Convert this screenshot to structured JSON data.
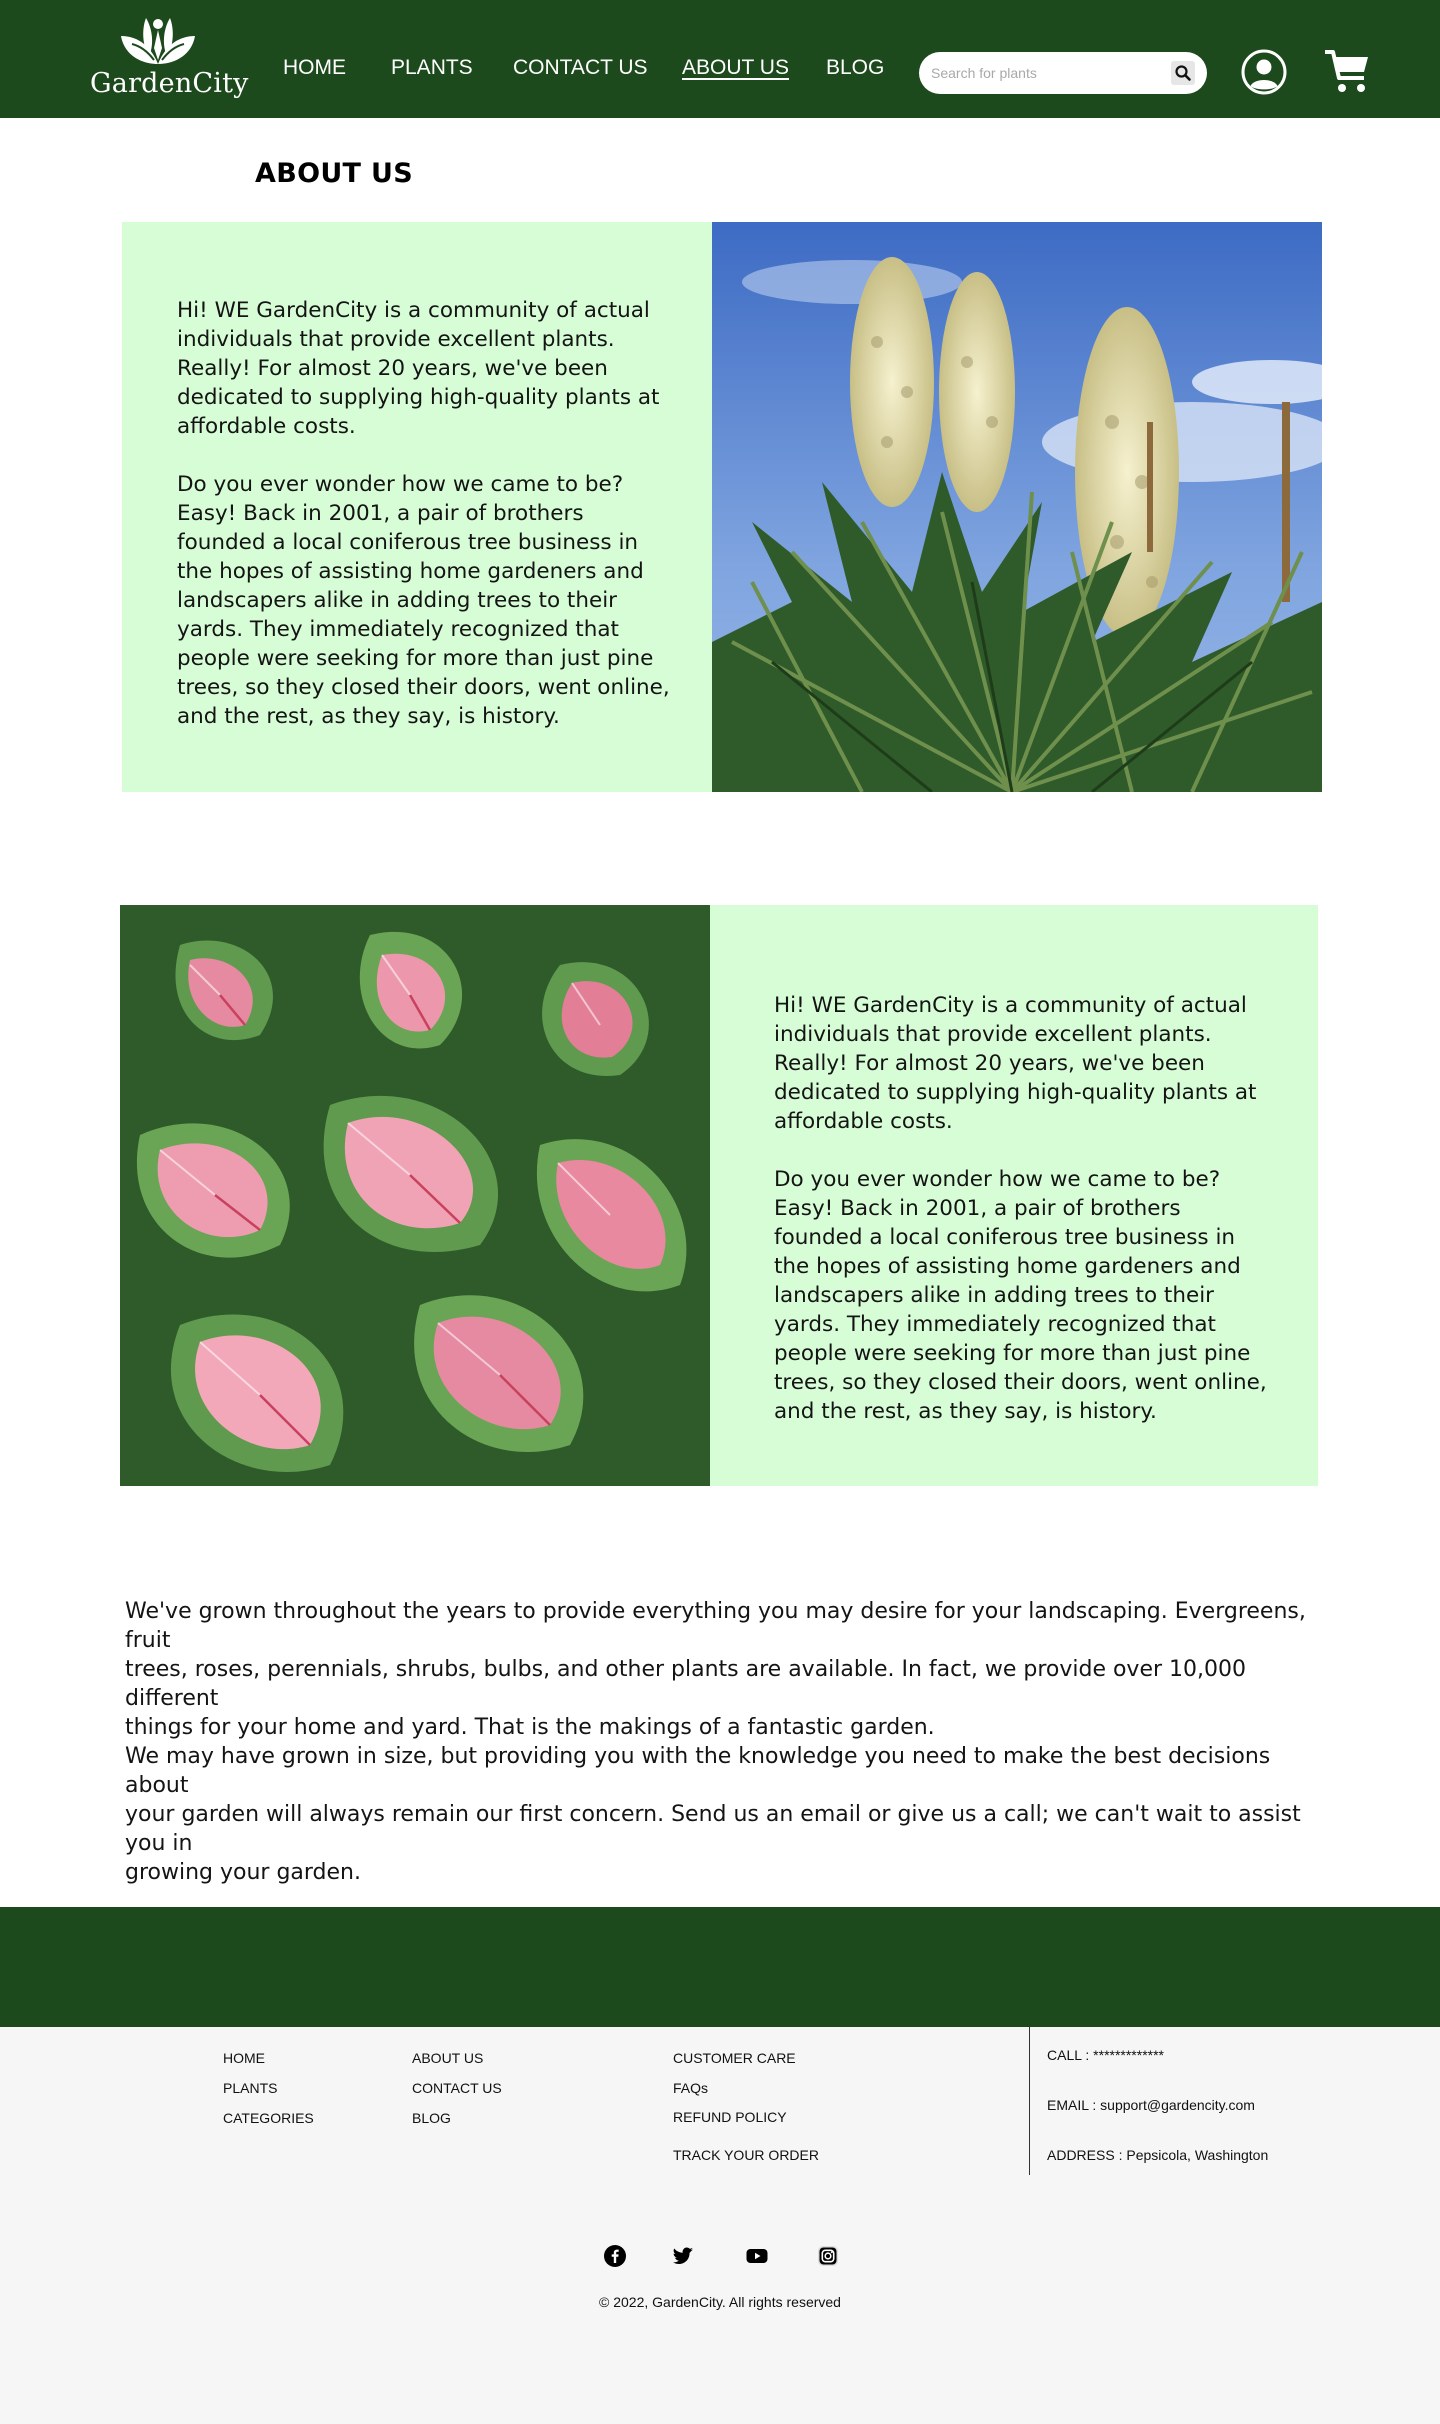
{
  "brand": {
    "name": "GardenCity",
    "color_primary": "#1d4a1d",
    "color_panel": "#d7fdd7"
  },
  "nav": {
    "items": [
      {
        "label": "HOME",
        "active": false
      },
      {
        "label": "PLANTS",
        "active": false
      },
      {
        "label": "CONTACT US",
        "active": false
      },
      {
        "label": "ABOUT US",
        "active": true
      },
      {
        "label": "BLOG",
        "active": false
      }
    ]
  },
  "search": {
    "placeholder": "Search for plants",
    "icon": "search-icon"
  },
  "header_icons": {
    "account": "account-icon",
    "cart": "cart-icon"
  },
  "page": {
    "title": "ABOUT US"
  },
  "sections": [
    {
      "text": "Hi! WE  GardenCity is a community of actual\nindividuals that provide excellent plants.\nReally! For almost 20 years, we've been\ndedicated to supplying high-quality plants at\naffordable costs.\n\nDo you ever wonder how we came to be?\nEasy! Back in 2001, a pair of brothers\nfounded a local coniferous tree business in\nthe hopes of assisting home gardeners and\nlandscapers alike in adding trees to their\nyards. They immediately recognized that\npeople were seeking for more than just pine\ntrees, so they closed their doors, went online,\nand the rest, as they say, is history.",
      "image": "yucca-flowers-photo"
    },
    {
      "text": "Hi! WE  GardenCity is a community of actual\nindividuals that provide excellent plants.\nReally! For almost 20 years, we've been\ndedicated to supplying high-quality plants at\naffordable costs.\n\nDo you ever wonder how we came to be?\nEasy! Back in 2001, a pair of brothers\nfounded a local coniferous tree business in\nthe hopes of assisting home gardeners and\nlandscapers alike in adding trees to their\nyards. They immediately recognized that\npeople were seeking for more than just pine\ntrees, so they closed their doors, went online,\nand the rest, as they say, is history.",
      "image": "caladium-leaves-photo"
    }
  ],
  "closing_text": "We've grown throughout the years to provide everything you may desire for your landscaping. Evergreens, fruit\ntrees, roses, perennials, shrubs, bulbs, and other plants are available. In fact, we provide over 10,000 different\nthings for your home and yard. That is the makings of a fantastic garden.\nWe may have grown in size, but providing you with the knowledge you need to make the best decisions about\nyour garden will always remain our first concern. Send us an email or give us a call; we can't wait to assist you in\ngrowing your garden.",
  "footer": {
    "col1": [
      "HOME",
      "PLANTS",
      "CATEGORIES"
    ],
    "col2": [
      "ABOUT US",
      "CONTACT US",
      "BLOG"
    ],
    "col3": [
      "CUSTOMER CARE",
      "FAQs",
      "REFUND POLICY",
      "TRACK YOUR ORDER"
    ],
    "contact": {
      "call": "CALL : *************",
      "email": "EMAIL : support@gardencity.com",
      "address": "ADDRESS : Pepsicola, Washington"
    },
    "social": [
      "facebook-icon",
      "twitter-icon",
      "youtube-icon",
      "instagram-icon"
    ],
    "copyright": "© 2022, GardenCity. All rights reserved"
  }
}
